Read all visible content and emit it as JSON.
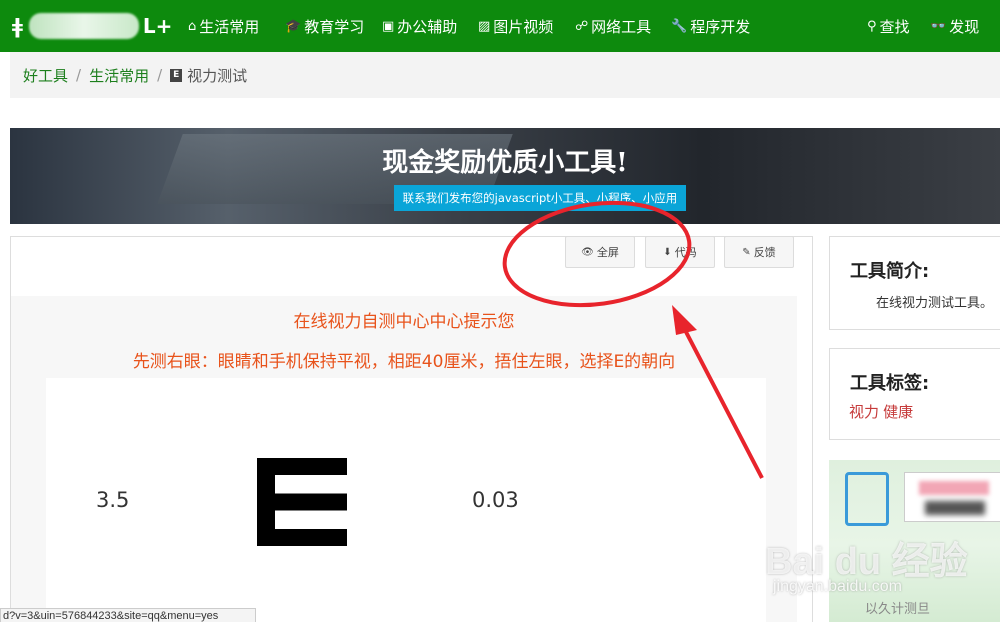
{
  "navbar": {
    "logo_left": "ǂ",
    "logo_right": "L+",
    "items": [
      {
        "icon": "home-icon",
        "glyph": "⌂",
        "label": "生活常用"
      },
      {
        "icon": "graduation-cap-icon",
        "glyph": "🎓",
        "label": "教育学习"
      },
      {
        "icon": "briefcase-icon",
        "glyph": "▣",
        "label": "办公辅助"
      },
      {
        "icon": "image-icon",
        "glyph": "▨",
        "label": "图片视频"
      },
      {
        "icon": "network-icon",
        "glyph": "☍",
        "label": "网络工具"
      },
      {
        "icon": "wrench-icon",
        "glyph": "🔧",
        "label": "程序开发"
      }
    ],
    "search": {
      "glyph": "⚲",
      "label": "查找"
    },
    "discover": {
      "glyph": "👓",
      "label": "发现"
    }
  },
  "breadcrumb": {
    "home": "好工具",
    "category": "生活常用",
    "current_icon": "E",
    "current": "视力测试"
  },
  "banner": {
    "title": "现金奖励优质小工具!",
    "subtitle": "联系我们发布您的javascript小工具、小程序、小应用"
  },
  "toolbar": {
    "fullscreen": {
      "glyph": "👁",
      "label": "全屏"
    },
    "code": {
      "glyph": "⬇",
      "label": "代码"
    },
    "feedback": {
      "glyph": "✎",
      "label": "反馈"
    }
  },
  "test": {
    "header": "在线视力自测中心中心提示您",
    "instruction": "先测右眼：眼睛和手机保持平视，相距40厘米，捂住左眼，选择E的朝向",
    "left_value": "3.5",
    "right_value": "0.03"
  },
  "sidebar": {
    "intro_title": "工具简介:",
    "intro_text": "在线视力测试工具。",
    "tags_title": "工具标签:",
    "tags": [
      "视力",
      "健康"
    ]
  },
  "watermark": {
    "brand": "Bai du 经验",
    "url": "jingyan.baidu.com",
    "bottom_text": "以久计测旦"
  },
  "statusbar": {
    "text": "d?v=3&uin=576844233&site=qq&menu=yes"
  },
  "colors": {
    "nav_bg": "#0d8a0d",
    "link_green": "#1d7f1d",
    "banner_button": "#0aa5d8",
    "instruction_red": "#e8531b",
    "tag_red": "#c63b3b",
    "annotation_red": "#e8242c"
  }
}
